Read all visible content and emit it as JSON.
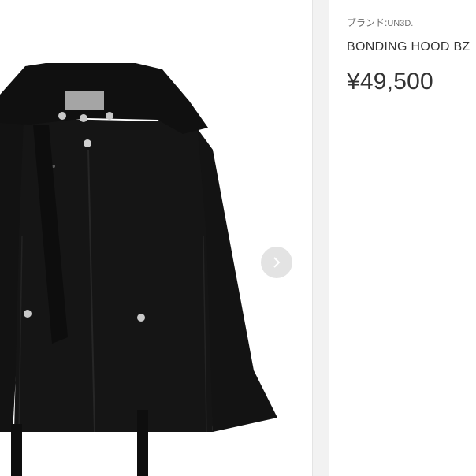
{
  "product": {
    "brand_label": "ブランド:",
    "brand_value": "UN3D.",
    "name": "BONDING HOOD BZ",
    "price": "¥49,500",
    "image_subject": "black hooded jacket"
  },
  "gallery": {
    "next_icon": "chevron-right-icon",
    "button_color": "#e3e3e3"
  },
  "colors": {
    "jacket": "#141414",
    "text": "#333333",
    "muted_text": "#6e6e6e"
  }
}
